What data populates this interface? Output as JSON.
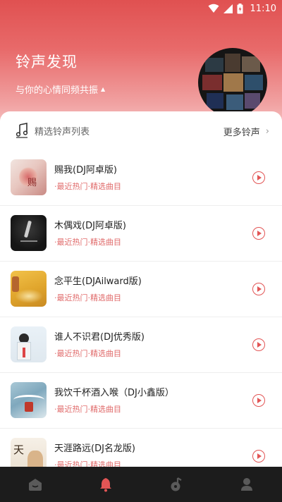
{
  "status_bar": {
    "time": "11:10",
    "icons": [
      "wifi-icon",
      "signal-icon",
      "battery-icon"
    ]
  },
  "hero": {
    "title": "铃声发现",
    "subtitle": "与你的心情同频共振",
    "subtitle_caret": "▲",
    "disc_image": "album-collage"
  },
  "section": {
    "icon": "music-note-icon",
    "title": "精选铃声列表",
    "more_label": "更多铃声",
    "more_chevron": "›"
  },
  "songs": [
    {
      "title": "赐我(DJ阿卓版)",
      "tag": "·最近热门·精选曲目",
      "cover": "floral-art-cover",
      "action_icon": "play-icon"
    },
    {
      "title": "木偶戏(DJ阿卓版)",
      "tag": "·最近热门·精选曲目",
      "cover": "dark-dancer-cover",
      "action_icon": "play-icon"
    },
    {
      "title": "念平生(DJAilward版)",
      "tag": "·最近热门·精选曲目",
      "cover": "golden-leaves-cover",
      "action_icon": "play-icon"
    },
    {
      "title": "谁人不识君(DJ优秀版)",
      "tag": "·最近热门·精选曲目",
      "cover": "portrait-cover",
      "action_icon": "play-icon"
    },
    {
      "title": "我饮千杯酒入喉（DJ小鑫版）",
      "tag": "·最近热门·精选曲目",
      "cover": "blue-waves-cover",
      "action_icon": "play-icon"
    },
    {
      "title": "天涯路远(DJ名龙版)",
      "tag": "·最近热门·精选曲目",
      "cover": "calligraphy-cover",
      "action_icon": "play-icon"
    }
  ],
  "tab_bar": {
    "tabs": [
      {
        "icon": "home-icon",
        "active": false
      },
      {
        "icon": "bell-icon",
        "active": true
      },
      {
        "icon": "music-icon",
        "active": false
      },
      {
        "icon": "profile-icon",
        "active": false
      }
    ]
  },
  "colors": {
    "accent": "#e25555",
    "tag_text": "#e06a6a",
    "tab_bar_bg": "#1c1c1c",
    "hero_gradient_top": "#e05151",
    "hero_gradient_bottom": "#f9dada"
  }
}
